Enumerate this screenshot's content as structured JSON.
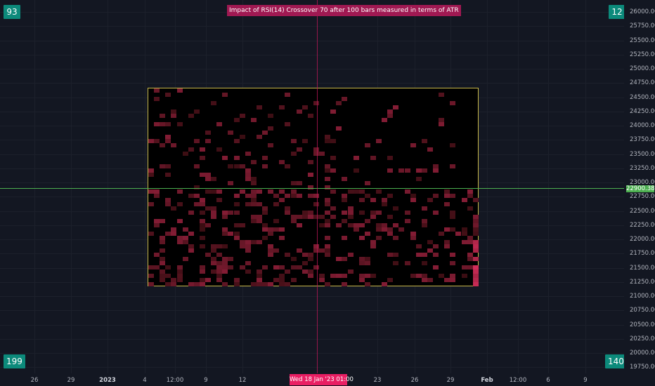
{
  "title": "Impact of RSI(14) Crossover 70 after 100 bars measured in terms of ATR",
  "corners": {
    "top_left": "93",
    "top_right": "12",
    "bottom_left": "199",
    "bottom_right": "140"
  },
  "price_axis": {
    "labels": [
      "26000.00",
      "25750.00",
      "25500.00",
      "25250.00",
      "25000.00",
      "24750.00",
      "24500.00",
      "24250.00",
      "24000.00",
      "23750.00",
      "23500.00",
      "23250.00",
      "23000.00",
      "22750.00",
      "22500.00",
      "22250.00",
      "22000.00",
      "21750.00",
      "21500.00",
      "21250.00",
      "21000.00",
      "20750.00",
      "20500.00",
      "20250.00",
      "20000.00",
      "19750.00"
    ],
    "current_price": "22900.38"
  },
  "time_axis": {
    "labels": [
      "26",
      "29",
      "2023",
      "4",
      "12:00",
      "9",
      "12",
      "23",
      "26",
      "29",
      "Feb",
      "12:00",
      "6",
      "9"
    ],
    "crosshair_label": "Wed 18 Jan '23   01:00"
  },
  "colors": {
    "background": "#131722",
    "box_border": "#c9b949",
    "horizontal_line": "#4caf50",
    "crosshair": "#e91e63",
    "badge": "#0c8a7b",
    "title_bg": "#a01952",
    "heat_low": "#3a0d12",
    "heat_high": "#e03060"
  }
}
